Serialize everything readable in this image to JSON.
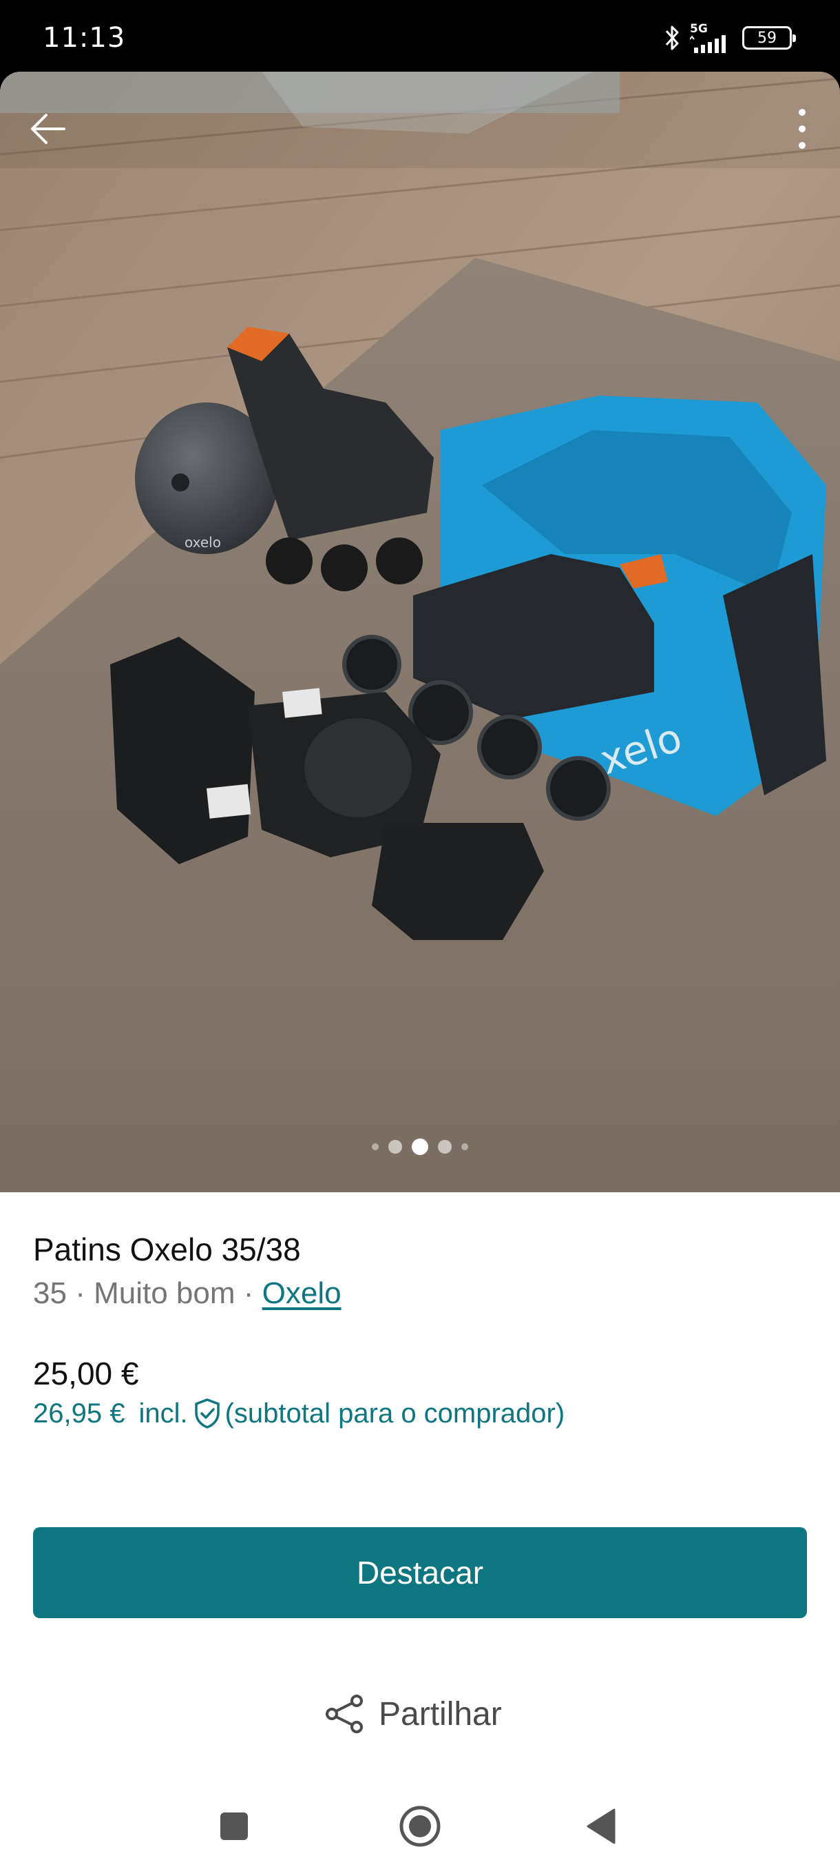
{
  "status_bar": {
    "time": "11:13",
    "network": "5G",
    "battery": "59"
  },
  "gallery": {
    "page_count": 5,
    "active_index": 2,
    "back_icon": "arrow-left-icon",
    "menu_icon": "more-vertical-icon"
  },
  "listing": {
    "title": "Patins Oxelo 35/38",
    "size": "35",
    "condition": "Muito bom",
    "separator": "·",
    "brand": "Oxelo",
    "price": "25,00 €",
    "buyer_price": "26,95 €",
    "incl_label": "incl.",
    "buyer_note": "(subtotal para o comprador)",
    "protection_icon": "shield-check-icon"
  },
  "actions": {
    "primary_label": "Destacar",
    "share_label": "Partilhar",
    "share_icon": "share-icon"
  },
  "colors": {
    "accent": "#0d7680",
    "text": "#111111",
    "muted": "#757575"
  },
  "nav": {
    "recents_icon": "square-icon",
    "home_icon": "circle-icon",
    "back_icon": "triangle-back-icon"
  }
}
